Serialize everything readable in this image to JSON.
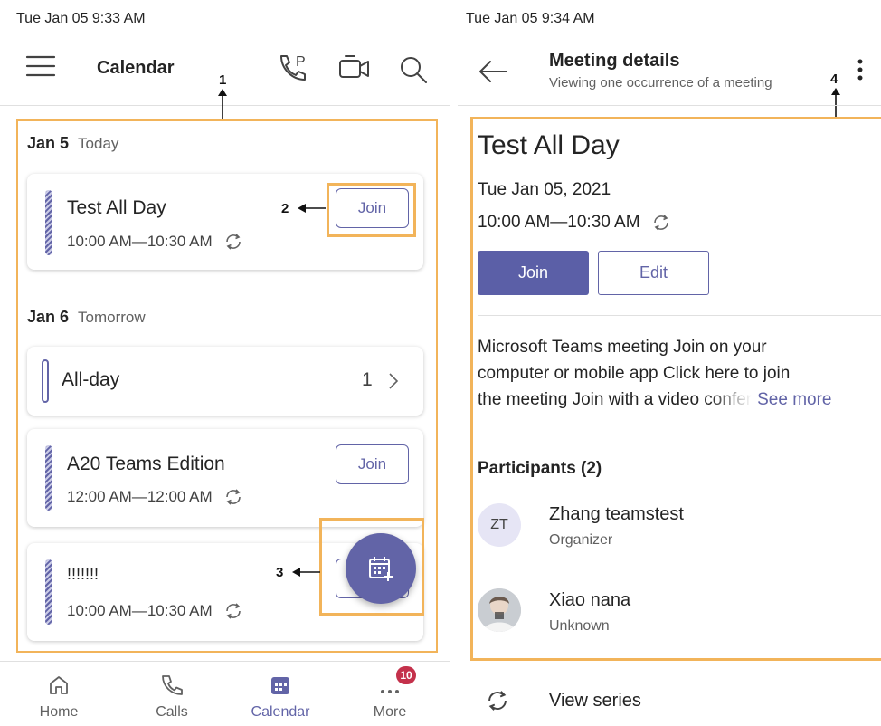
{
  "left": {
    "status_time": "Tue Jan 05  9:33 AM",
    "header": {
      "title": "Calendar"
    },
    "callouts": [
      "1",
      "2",
      "3"
    ],
    "days": [
      {
        "date": "Jan 5",
        "label": "Today",
        "events": [
          {
            "title": "Test All Day",
            "time": "10:00 AM—10:30 AM",
            "join_label": "Join"
          }
        ]
      },
      {
        "date": "Jan 6",
        "label": "Tomorrow",
        "allday": {
          "label": "All-day",
          "count": "1"
        },
        "events": [
          {
            "title": "A20 Teams Edition",
            "time": "12:00 AM—12:00 AM",
            "join_label": "Join"
          },
          {
            "title": "!!!!!!!",
            "time": "10:00 AM—10:30 AM"
          }
        ]
      }
    ],
    "nav": {
      "items": [
        {
          "label": "Home",
          "icon": "home-icon"
        },
        {
          "label": "Calls",
          "icon": "phone-icon"
        },
        {
          "label": "Calendar",
          "icon": "calendar-icon"
        },
        {
          "label": "More",
          "icon": "more-icon"
        }
      ],
      "more_badge": "10"
    },
    "colors": {
      "accent": "#6264A7",
      "highlight": "#F2B45A",
      "badge": "#C4314B"
    }
  },
  "right": {
    "status_time": "Tue Jan 05  9:34 AM",
    "header": {
      "title": "Meeting details",
      "subtitle": "Viewing one occurrence of a meeting"
    },
    "callout": "4",
    "meeting": {
      "title": "Test All Day",
      "date": "Tue Jan 05, 2021",
      "time": "10:00 AM—10:30 AM",
      "join_label": "Join",
      "edit_label": "Edit",
      "description_lines": [
        "Microsoft Teams meeting Join on your",
        "computer or mobile app Click here to join",
        "the meeting Join with a video confer"
      ],
      "see_more": "See more"
    },
    "participants": {
      "heading": "Participants (2)",
      "list": [
        {
          "initials": "ZT",
          "name": "Zhang teamstest",
          "role": "Organizer"
        },
        {
          "initials": "",
          "name": "Xiao nana",
          "role": "Unknown"
        }
      ]
    },
    "view_series": "View series"
  }
}
